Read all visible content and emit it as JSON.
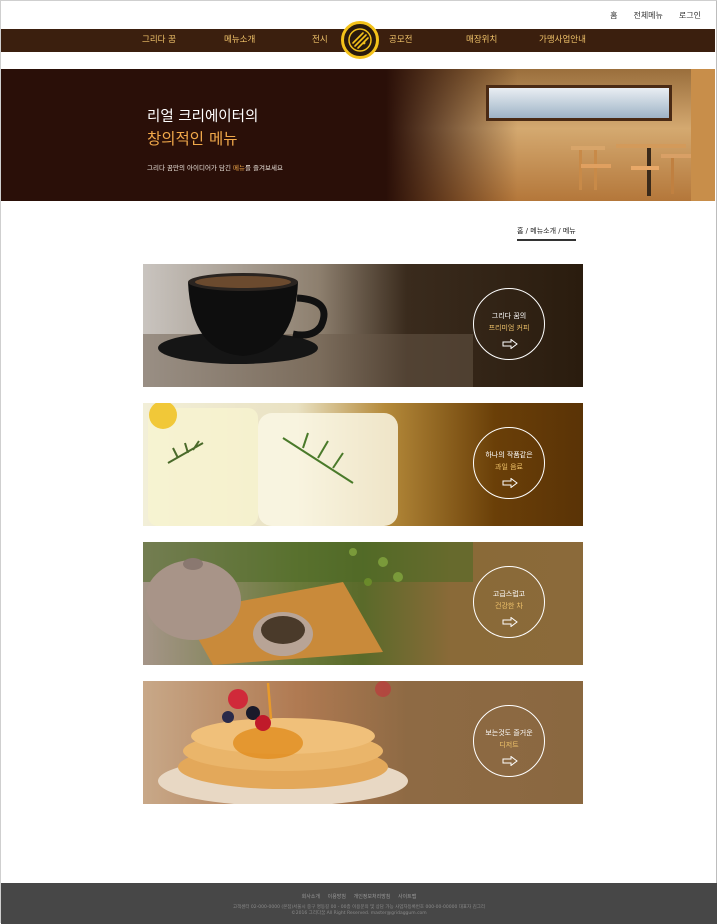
{
  "utility_nav": [
    "홈",
    "전체메뉴",
    "로그인"
  ],
  "nav": {
    "left": [
      "그리다 꿈",
      "메뉴소개",
      "전시"
    ],
    "right": [
      "공모전",
      "매장위치",
      "가맹사업안내"
    ]
  },
  "hero": {
    "line1": "리얼 크리에이터의",
    "line2": "창의적인 메뉴",
    "sub_before": "그리다 꿈만의 아이디어가 담긴",
    "sub_highlight": "메뉴",
    "sub_after": "를 즐겨보세요"
  },
  "breadcrumb": "홈 / 메뉴소개 / 메뉴",
  "cards": [
    {
      "line1": "그리다 꿈의",
      "line2": "프리미엄 커피"
    },
    {
      "line1": "하나의 작품같은",
      "line2": "과일 음료"
    },
    {
      "line1": "고급스럽고",
      "line2": "건강한 차"
    },
    {
      "line1": "보는것도 즐거운",
      "line2": "디저트"
    }
  ],
  "footer": {
    "links": "회사소개 이용방침 개인정보처리방침 사이트맵",
    "info": "고객센터 02-000-0000  (본점)서울시 중구 명동길 00 - 00층  이용문의 및 상담 가능  사업자등록번호 000-00-00000  대표자 김그리",
    "copy": "©2016 그리다꿈 All Right Reserved. master@gridaggum.com"
  }
}
